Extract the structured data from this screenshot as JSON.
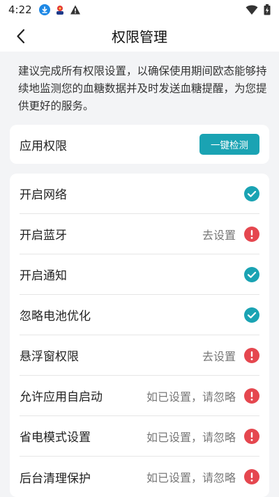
{
  "status_bar": {
    "time": "4:22",
    "icons_left": [
      "download-icon",
      "app-notification-icon",
      "warning-icon"
    ],
    "icons_right": [
      "wifi-icon",
      "battery-icon"
    ]
  },
  "header": {
    "title": "权限管理",
    "back_icon": "back-arrow-icon"
  },
  "intro_text": "建议完成所有权限设置，以确保使用期间欧态能够持续地监测您的血糖数据并及时发送血糖提醒，为您提供更好的服务。",
  "app_permissions": {
    "label": "应用权限",
    "button_label": "一键检测"
  },
  "colors": {
    "accent": "#1aa3b3",
    "ok": "#1aa3b3",
    "warn": "#e5474f"
  },
  "permissions": [
    {
      "name": "开启网络",
      "action": "",
      "status": "ok"
    },
    {
      "name": "开启蓝牙",
      "action": "去设置",
      "status": "warn"
    },
    {
      "name": "开启通知",
      "action": "",
      "status": "ok"
    },
    {
      "name": "忽略电池优化",
      "action": "",
      "status": "ok"
    },
    {
      "name": "悬浮窗权限",
      "action": "去设置",
      "status": "warn"
    },
    {
      "name": "允许应用自启动",
      "action": "如已设置，请忽略",
      "status": "warn"
    },
    {
      "name": "省电模式设置",
      "action": "如已设置，请忽略",
      "status": "warn"
    },
    {
      "name": "后台清理保护",
      "action": "如已设置，请忽略",
      "status": "warn"
    }
  ]
}
